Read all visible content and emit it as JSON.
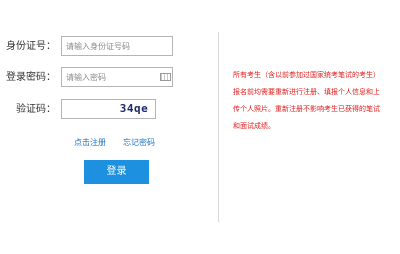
{
  "form": {
    "id_label": "身份证号：",
    "id_placeholder": "请输入身份证号码",
    "password_label": "登录密码：",
    "password_placeholder": "请输入密码",
    "captcha_label": "验证码：",
    "captcha_code": "34qe",
    "register_link": "点击注册",
    "forgot_link": "忘记密码",
    "login_button": "登录"
  },
  "notice": {
    "text": "所有考生（含以前参加过国家统考笔试的考生）报名前均需要重新进行注册、填报个人信息和上传个人照片。重新注册不影响考生已获得的笔试和面试成绩。"
  },
  "colors": {
    "accent": "#1e90e0",
    "link": "#1d73c9",
    "notice": "#e01a1a"
  },
  "icons": {
    "keyboard": "keyboard-icon"
  }
}
